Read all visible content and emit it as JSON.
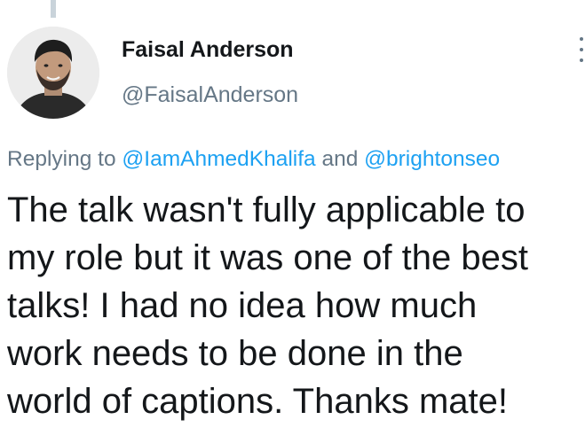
{
  "author": {
    "name": "Faisal Anderson",
    "handle": "@FaisalAnderson"
  },
  "reply": {
    "prefix": "Replying to ",
    "mention_1": "@IamAhmedKhalifa",
    "connector": " and ",
    "mention_2": "@brightonseo"
  },
  "tweet": {
    "text": "The talk wasn't fully applicable to\nmy role but it was one of the best\ntalks! I had no idea how much\nwork needs to be done in the\nworld of captions. Thanks mate!"
  },
  "colors": {
    "link": "#1da1f2",
    "secondary_text": "#657786",
    "primary_text": "#14171a"
  },
  "icons": {
    "more": "more-options-icon"
  }
}
